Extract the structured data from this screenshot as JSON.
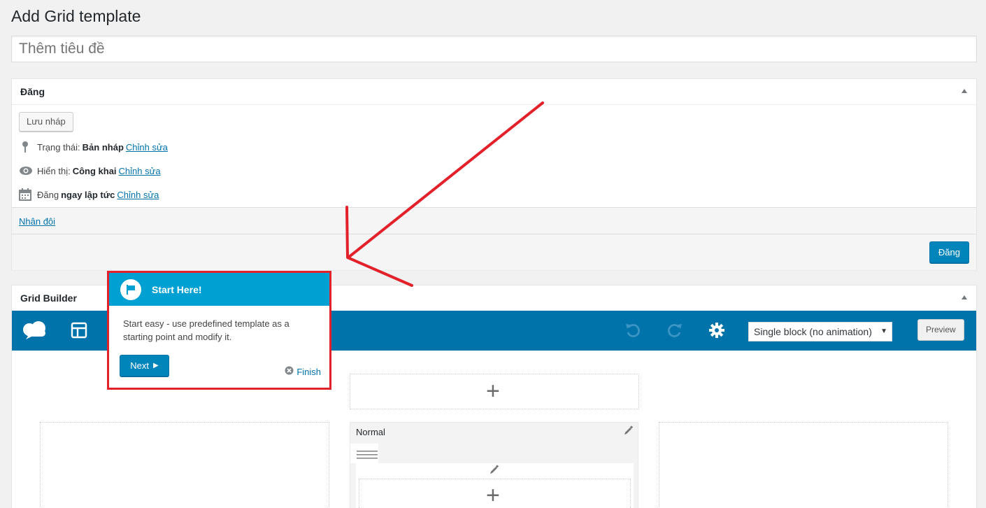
{
  "page": {
    "title": "Add Grid template"
  },
  "title_input": {
    "placeholder": "Thêm tiêu đề"
  },
  "publish_box": {
    "heading": "Đăng",
    "save_draft": "Lưu nháp",
    "status_label": "Trạng thái:",
    "status_value": "Bản nháp",
    "visibility_label": "Hiển thị:",
    "visibility_value": "Công khai",
    "publish_label": "Đăng",
    "publish_value": "ngay lập tức",
    "edit_link": "Chỉnh sửa",
    "duplicate": "Nhân đôi",
    "publish_button": "Đăng"
  },
  "grid_builder": {
    "heading": "Grid Builder",
    "animation_select": "Single block (no animation)",
    "preview_button": "Preview",
    "block_label": "Normal"
  },
  "tour": {
    "title": "Start Here!",
    "body": "Start easy - use predefined template as a starting point and modify it.",
    "next": "Next",
    "finish": "Finish"
  },
  "colors": {
    "accent": "#0073aa",
    "tour_header": "#00a0d2",
    "annotation": "#e2212a"
  },
  "icons": [
    "pin-icon",
    "eye-icon",
    "calendar-icon",
    "cloud-logo-icon",
    "layout-icon",
    "undo-icon",
    "redo-icon",
    "gear-icon",
    "flag-icon",
    "close-circle-icon",
    "pencil-icon",
    "drag-handle-icon",
    "plus-icon"
  ]
}
